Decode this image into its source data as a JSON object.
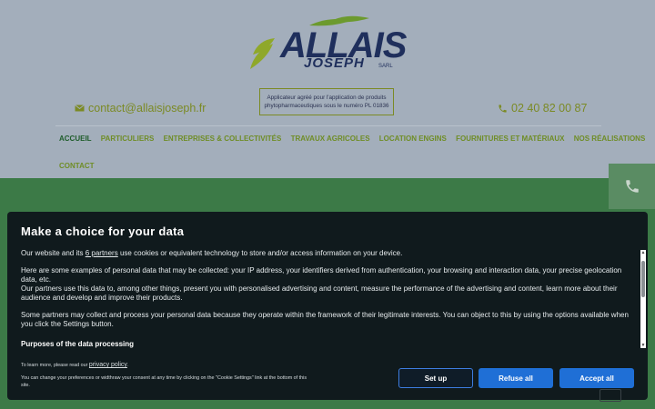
{
  "brand": {
    "name": "ALLAIS",
    "sub": "JOSEPH",
    "suffix": "SARL",
    "approval": "Applicateur agréé pour l'application de produits phytopharmaceutiques sous le numéro PL 01836"
  },
  "contact": {
    "email": "contact@allaisjoseph.fr",
    "phone": "02 40 82 00 87"
  },
  "nav": {
    "row1": [
      "ACCUEIL",
      "PARTICULIERS",
      "ENTREPRISES & COLLECTIVITÉS",
      "TRAVAUX AGRICOLES",
      "LOCATION ENGINS",
      "FOURNITURES ET MATÉRIAUX",
      "NOS RÉALISATIONS"
    ],
    "row2": [
      "CONTACT"
    ]
  },
  "consent": {
    "title": "Make a choice for your data",
    "p1_a": "Our website and its ",
    "p1_link": "6 partners",
    "p1_b": " use cookies or equivalent technology to store and/or access information on your device.",
    "p2": "Here are some examples of personal data that may be collected: your IP address, your identifiers derived from authentication, your browsing and interaction data, your precise geolocation data, etc.",
    "p3": "Our partners use this data to, among other things, present you with personalised advertising and content, measure the performance of the advertising and content, learn more about their audience and develop and improve their products.",
    "p4": "Some partners may collect and process your personal data because they operate within the framework of their legitimate interests. You can object to this by using the options available when you click the Settings button.",
    "purposes": "Purposes of the data processing",
    "learn_a": "To learn more, please read our ",
    "learn_link": "privacy policy",
    "learn_b": ".",
    "change": "You can change your preferences or widthraw your consent at any time by clicking on the \"Cookie Settings\" link at the bottom of this site.",
    "btn_setup": "Set up",
    "btn_refuse": "Refuse all",
    "btn_accept": "Accept all"
  }
}
